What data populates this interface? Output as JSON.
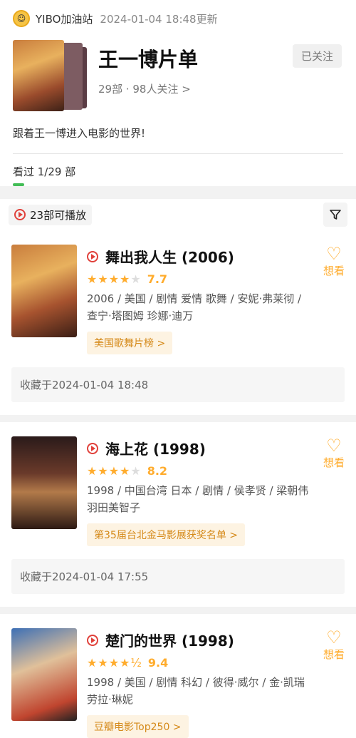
{
  "header": {
    "user": "YIBO加油站",
    "updated": "2024-01-04 18:48更新",
    "title": "王一博片单",
    "stats": "29部 · 98人关注 >",
    "follow_label": "已关注",
    "description": "跟着王一博进入电影的世界!",
    "watched": "看过  1/29 部",
    "watched_progress": 0.034
  },
  "filter_bar": {
    "playable": "23部可播放"
  },
  "movies": [
    {
      "title": "舞出我人生 (2006)",
      "stars": "★★★★",
      "stars_empty": "★",
      "score": "7.7",
      "desc": "2006 / 美国 / 剧情 爱情 歌舞 / 安妮·弗莱彻 / 查宁·塔图姆 珍娜·迪万",
      "tag": "美国歌舞片榜 >",
      "collected": "收藏于2024-01-04 18:48",
      "want": "想看"
    },
    {
      "title": "海上花 (1998)",
      "stars": "★★★★",
      "stars_empty": "★",
      "score": "8.2",
      "desc": "1998 / 中国台湾 日本 / 剧情 / 侯孝贤 / 梁朝伟 羽田美智子",
      "tag": "第35届台北金马影展获奖名单 >",
      "collected": "收藏于2024-01-04 17:55",
      "want": "想看"
    },
    {
      "title": "楚门的世界 (1998)",
      "stars": "★★★★",
      "stars_empty": "½",
      "score": "9.4",
      "desc": "1998 / 美国 / 剧情 科幻 / 彼得·威尔 / 金·凯瑞 劳拉·琳妮",
      "tag": "豆瓣电影Top250 >",
      "want": "想看"
    }
  ]
}
